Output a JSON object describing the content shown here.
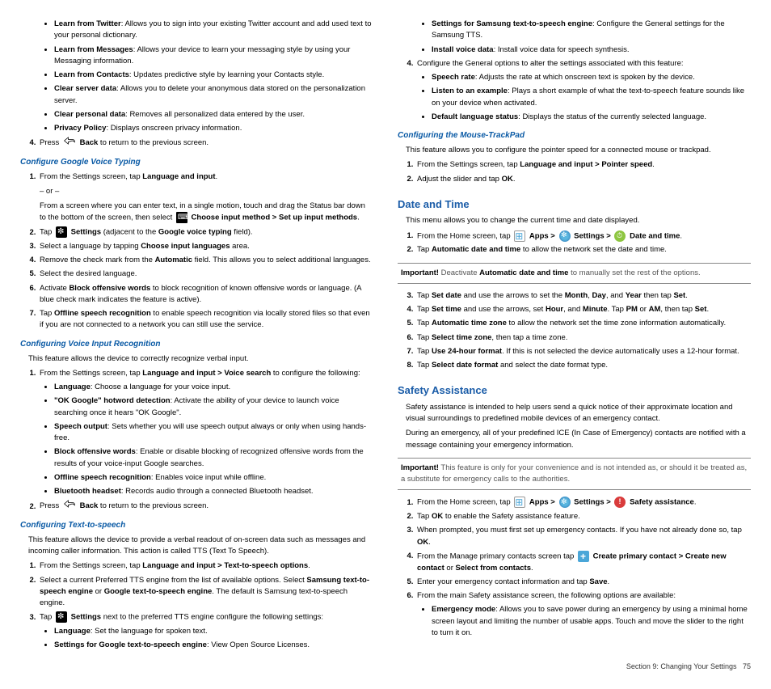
{
  "left": {
    "b1": [
      {
        "t": "Learn from Twitter",
        "d": ": Allows you to sign into your existing Twitter account and add used text to your personal dictionary."
      },
      {
        "t": "Learn from Messages",
        "d": ": Allows your device to learn your messaging style by using your Messaging information."
      },
      {
        "t": "Learn from Contacts",
        "d": ": Updates predictive style by learning your Contacts style."
      },
      {
        "t": "Clear server data",
        "d": ": Allows you to delete your anonymous data stored on the personalization server."
      },
      {
        "t": "Clear personal data",
        "d": ": Removes all personalized data entered by the user."
      },
      {
        "t": "Privacy Policy",
        "d": ": Displays onscreen privacy information."
      }
    ],
    "press4a": "Press ",
    "press4b": "Back",
    "press4c": " to return to the previous screen.",
    "h1": "Configure Google Voice Typing",
    "gv1a": "From the Settings screen, tap ",
    "gv1b": "Language and input",
    "or": "– or –",
    "gv1c": "From a screen where you can enter text, in a single motion, touch and drag the Status bar down to the bottom of the screen, then select ",
    "gv1d": "Choose input method > Set up input methods",
    "gv2a": "Tap ",
    "gv2b": "Settings",
    "gv2c": " (adjacent to the ",
    "gv2d": "Google voice typing",
    "gv2e": " field).",
    "gv3a": "Select a language by tapping ",
    "gv3b": "Choose input languages",
    "gv3c": " area.",
    "gv4a": "Remove the check mark from the ",
    "gv4b": "Automatic",
    "gv4c": " field. This allows you to select additional languages.",
    "gv5": "Select the desired language.",
    "gv6a": "Activate ",
    "gv6b": "Block offensive words",
    "gv6c": " to block recognition of known offensive words or language. (A blue check mark indicates the feature is active).",
    "gv7a": "Tap ",
    "gv7b": "Offline speech recognition",
    "gv7c": " to enable speech recognition via locally stored files so that even if you are not connected to a network you can still use the service.",
    "h2": "Configuring Voice Input Recognition",
    "vr_intro": "This feature allows the device to correctly recognize verbal input.",
    "vr1a": "From the Settings screen, tap ",
    "vr1b": "Language and input > Voice search",
    "vr1c": " to configure the following:",
    "vr_b": [
      {
        "t": "Language",
        "d": ": Choose a language for your voice input."
      },
      {
        "t": "\"OK Google\" hotword detection",
        "d": ": Activate the ability of your device to launch voice searching once it hears \"OK Google\"."
      },
      {
        "t": "Speech output",
        "d": ": Sets whether you will use speech output always or only when using hands-free."
      },
      {
        "t": "Block offensive words",
        "d": ": Enable or disable blocking of recognized offensive words from the results of your voice-input Google searches."
      },
      {
        "t": "Offline speech recognition",
        "d": ": Enables voice input while offline."
      },
      {
        "t": "Bluetooth headset",
        "d": ": Records audio through a connected Bluetooth headset."
      }
    ],
    "vr2a": "Press ",
    "vr2b": "Back",
    "vr2c": " to return to the previous screen.",
    "h3": "Configuring Text-to-speech",
    "ts_intro": "This feature allows the device to provide a verbal readout of on-screen data such as messages and incoming caller information. This action is called TTS (Text To Speech).",
    "ts1a": "From the Settings screen, tap ",
    "ts1b": "Language and input > Text-to-speech options",
    "ts2a": "Select a current Preferred TTS engine from the list of available options. Select ",
    "ts2b": "Samsung text-to-speech engine",
    "ts2c": " or ",
    "ts2d": "Google text-to-speech engine",
    "ts2e": ". The default is Samsung text-to-speech engine.",
    "ts3a": "Tap ",
    "ts3b": "Settings",
    "ts3c": " next to the preferred TTS engine configure the following settings:",
    "ts_b": [
      {
        "t": "Language",
        "d": ": Set the language for spoken text."
      },
      {
        "t": "Settings for Google text-to-speech engine",
        "d": ": View Open Source Licenses."
      }
    ]
  },
  "right": {
    "ts_b2": [
      {
        "t": "Settings for Samsung text-to-speech engine",
        "d": ": Configure the General settings for the Samsung TTS."
      },
      {
        "t": "Install voice data",
        "d": ": Install voice data for speech synthesis."
      }
    ],
    "ts4": "Configure the General options to alter the settings associated with this feature:",
    "ts4_b": [
      {
        "t": "Speech rate",
        "d": ": Adjusts the rate at which onscreen text is spoken by the device."
      },
      {
        "t": "Listen to an example",
        "d": ": Plays a short example of what the text-to-speech feature sounds like on your device when activated."
      },
      {
        "t": "Default language status",
        "d": ": Displays the status of the currently selected language."
      }
    ],
    "h4": "Configuring the Mouse-TrackPad",
    "mt_intro": "This feature allows you to configure the pointer speed for a connected mouse or trackpad.",
    "mt1a": "From the Settings screen, tap ",
    "mt1b": "Language and input > Pointer speed",
    "mt2a": "Adjust the slider and tap ",
    "mt2b": "OK",
    "h5": "Date and Time",
    "dt_intro": "This menu allows you to change the current time and date displayed.",
    "dt1a": "From the Home screen, tap ",
    "dt1b": "Apps > ",
    "dt1c": "Settings > ",
    "dt1d": "Date and time",
    "dt2a": "Tap ",
    "dt2b": "Automatic date and time",
    "dt2c": " to allow the network set the date and time.",
    "note1a": "Important!",
    "note1b": " Deactivate ",
    "note1c": "Automatic date and time",
    "note1d": " to manually set the rest of the options.",
    "dt3a": "Tap ",
    "dt3b": "Set date",
    "dt3c": " and use the arrows to set the ",
    "dt3d": "Month",
    "dt3e": ", ",
    "dt3f": "Day",
    "dt3g": ", and ",
    "dt3h": "Year",
    "dt3i": " then tap ",
    "dt3j": "Set",
    "dt4a": "Tap ",
    "dt4b": "Set time",
    "dt4c": " and use the arrows, set ",
    "dt4d": "Hour",
    "dt4e": ", and ",
    "dt4f": "Minute",
    "dt4g": ". Tap ",
    "dt4h": "PM",
    "dt4i": " or ",
    "dt4j": "AM",
    "dt4k": ", then tap ",
    "dt4l": "Set",
    "dt5a": "Tap ",
    "dt5b": "Automatic time zone",
    "dt5c": " to allow the network set the time zone information automatically.",
    "dt6a": "Tap ",
    "dt6b": "Select time zone",
    "dt6c": ", then tap a time zone.",
    "dt7a": "Tap ",
    "dt7b": "Use 24-hour format",
    "dt7c": ". If this is not selected the device automatically uses a 12-hour format.",
    "dt8a": "Tap ",
    "dt8b": "Select date format",
    "dt8c": " and select the date format type.",
    "h6": "Safety Assistance",
    "sa_intro1": "Safety assistance is intended to help users send a quick notice of their approximate location and visual surroundings to predefined mobile devices of an emergency contact.",
    "sa_intro2": "During an emergency, all of your predefined ICE (In Case of Emergency) contacts are notified with a message containing your emergency information.",
    "note2a": "Important!",
    "note2b": " This feature is only for your convenience and is not intended as, or should it be treated as, a substitute for emergency calls to the authorities.",
    "sa1a": "From the Home screen, tap ",
    "sa1b": "Apps > ",
    "sa1c": "Settings > ",
    "sa1d": "Safety assistance",
    "sa2a": "Tap ",
    "sa2b": "OK",
    "sa2c": " to enable the Safety assistance feature.",
    "sa3a": "When prompted, you must first set up emergency contacts. If you have not already done so, tap ",
    "sa3b": "OK",
    "sa4a": "From the Manage primary contacts screen tap ",
    "sa4b": "Create primary contact > Create new contact",
    "sa4c": " or ",
    "sa4d": "Select from contacts",
    "sa5a": "Enter your emergency contact information and tap ",
    "sa5b": "Save",
    "sa6": "From the main Safety assistance screen, the following options are available:",
    "sa_b": [
      {
        "t": "Emergency mode",
        "d": ": Allows you to save power during an emergency by using a minimal home screen layout and limiting the number of usable apps. Touch and move the slider to the right to turn it on."
      }
    ]
  },
  "footer_a": "Section 9:  Changing Your Settings",
  "footer_b": "75"
}
